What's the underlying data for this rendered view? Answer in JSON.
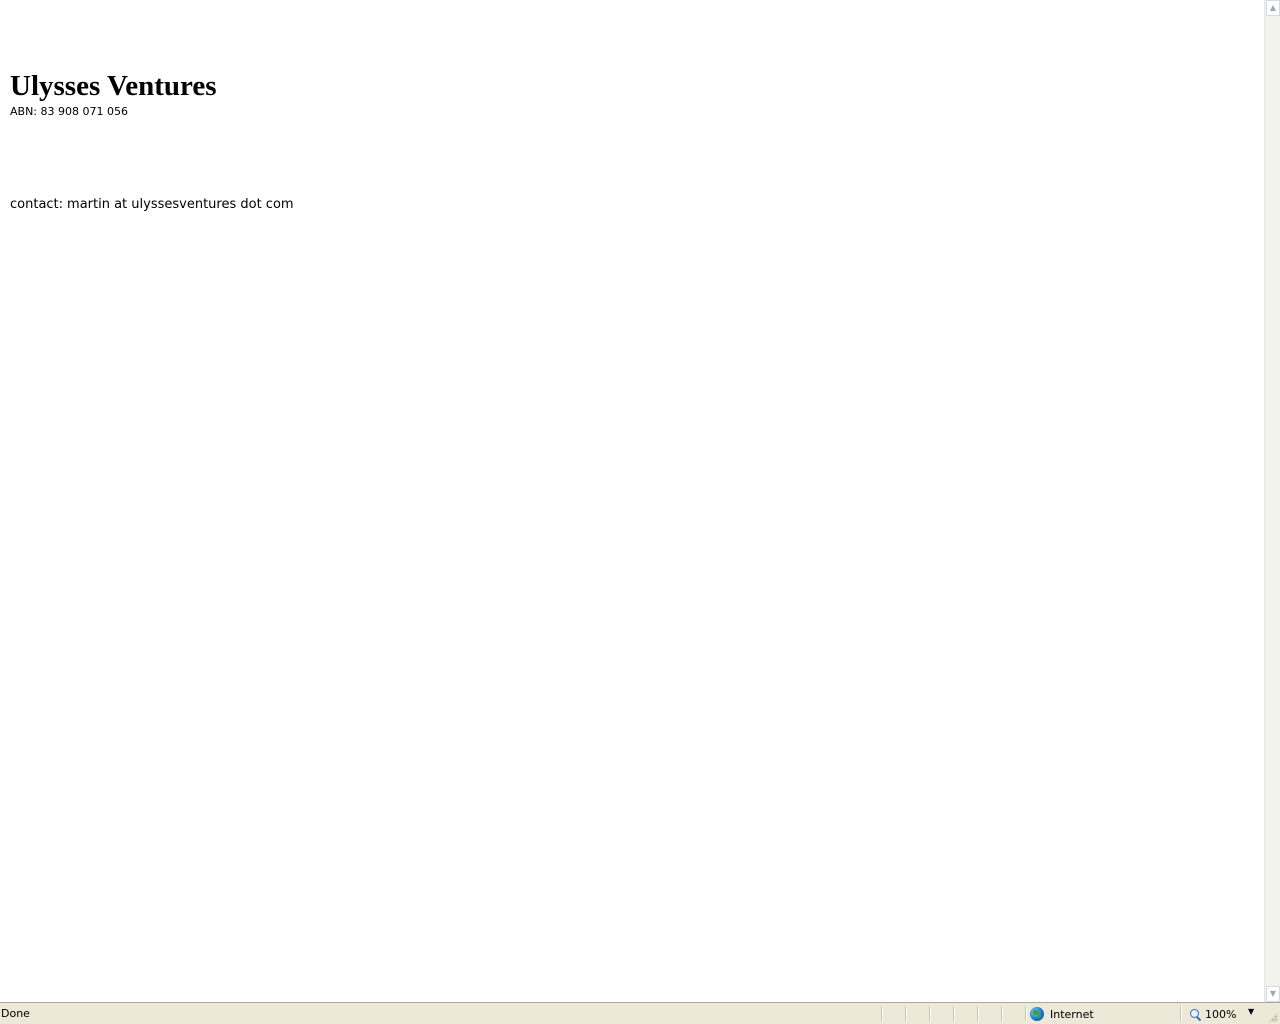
{
  "page": {
    "company_name": "Ulysses Ventures",
    "abn": "ABN: 83 908 071 056",
    "contact_label": "contact:",
    "contact_value": "martin at ulyssesventures dot com"
  },
  "statusbar": {
    "status_text": "Done",
    "zone_label": "Internet",
    "zone_icon": "globe-icon",
    "zoom_level": "100%",
    "zoom_icon": "magnifier-icon"
  },
  "scrollbar": {
    "up_arrow": "▲",
    "down_arrow": "▼"
  },
  "colors": {
    "page_background": "#ffffff",
    "statusbar_background": "#ece9d8",
    "text": "#000000"
  }
}
